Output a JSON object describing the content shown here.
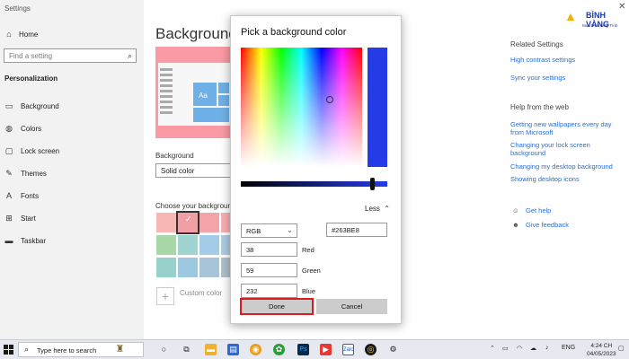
{
  "window": {
    "title": "Settings"
  },
  "nav": {
    "home": "Home",
    "search_placeholder": "Find a setting",
    "section": "Personalization",
    "items": [
      "Background",
      "Colors",
      "Lock screen",
      "Themes",
      "Fonts",
      "Start",
      "Taskbar"
    ]
  },
  "main": {
    "title": "Background",
    "preview_text": "Aa",
    "background_label": "Background",
    "background_value": "Solid color",
    "choose_label": "Choose your background",
    "custom_color": "Custom color",
    "swatches": [
      "#f7b8b4",
      "#f0a0a4",
      "#f4a4a8",
      "#f7b0b4",
      "#f2a8b0",
      "#a8d8a8",
      "#a0d4d0",
      "#a4cce8",
      "#b0cce0",
      "#acc4d4",
      "#98d0cc",
      "#9cc8e0",
      "#a8c4d8",
      "#b0c0cc",
      "#a8b8c4"
    ]
  },
  "right": {
    "related_heading": "Related Settings",
    "high_contrast": "High contrast settings",
    "sync": "Sync your settings",
    "help_heading": "Help from the web",
    "help_links": [
      "Getting new wallpapers every day",
      "from Microsoft",
      "Changing your lock screen",
      "background",
      "Changing my desktop background",
      "Showing desktop icons"
    ],
    "get_help": "Get help",
    "feedback": "Give feedback"
  },
  "logo": {
    "name": "BÌNH VÀNG",
    "tagline": "Mua tin là Máy Tính"
  },
  "dialog": {
    "title": "Pick a background color",
    "selected_color": "#263BE8",
    "less_label": "Less",
    "mode": "RGB",
    "hex_value": "#263BE8",
    "red_value": "38",
    "red_label": "Red",
    "green_value": "59",
    "green_label": "Green",
    "blue_value": "232",
    "blue_label": "Blue",
    "done_label": "Done",
    "cancel_label": "Cancel"
  },
  "taskbar": {
    "search_placeholder": "Type here to search",
    "lang": "ENG",
    "time": "4:24 CH",
    "date": "04/05/2023"
  }
}
